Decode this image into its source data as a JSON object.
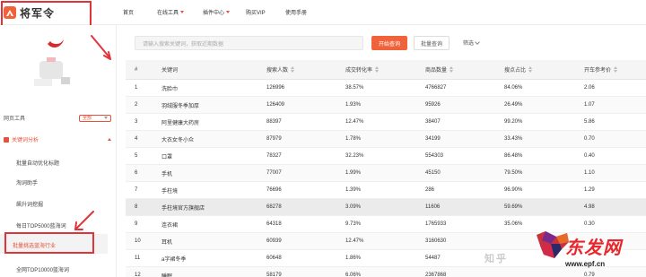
{
  "app": {
    "logo_text": "将军令"
  },
  "nav": [
    {
      "label": "首页",
      "has_caret": false
    },
    {
      "label": "在线工具",
      "has_caret": true
    },
    {
      "label": "插件中心",
      "has_caret": true
    },
    {
      "label": "购买VIP",
      "has_caret": false
    },
    {
      "label": "使用手册",
      "has_caret": false
    }
  ],
  "sidebar": {
    "tools_label": "网页工具",
    "tools_select": "全部",
    "category": "关键词分析",
    "items": [
      {
        "label": "批量自动优化标题",
        "active": false
      },
      {
        "label": "淘词助手",
        "active": false
      },
      {
        "label": "飙升词挖掘",
        "active": false
      },
      {
        "label": "每日TOP5000蓝海词",
        "active": false
      },
      {
        "label": "批量挑选蓝海行业",
        "active": true
      },
      {
        "label": "全网TOP10000蓝海词",
        "active": false
      }
    ]
  },
  "search": {
    "placeholder": "请输入搜索关键词，获取近期数据",
    "primary_button": "开始查询",
    "secondary_button": "批量查询",
    "filter_label": "筛选"
  },
  "table": {
    "columns": [
      "#",
      "关键词",
      "搜索人数",
      "成交转化率",
      "商品数量",
      "搜点占比",
      "开车参考价"
    ],
    "rows": [
      [
        "1",
        "洗脸巾",
        "126996",
        "38.57%",
        "4766827",
        "84.06%",
        "2.06"
      ],
      [
        "2",
        "羽绒服冬季加厚",
        "126409",
        "1.93%",
        "95926",
        "26.49%",
        "1.07"
      ],
      [
        "3",
        "阿里健康大药房",
        "88397",
        "12.47%",
        "38407",
        "99.20%",
        "5.86"
      ],
      [
        "4",
        "大衣女冬小众",
        "87979",
        "1.78%",
        "34199",
        "33.43%",
        "0.70"
      ],
      [
        "5",
        "口罩",
        "78327",
        "32.23%",
        "554303",
        "86.48%",
        "0.40"
      ],
      [
        "6",
        "手机",
        "77007",
        "1.99%",
        "45150",
        "79.50%",
        "1.10"
      ],
      [
        "7",
        "手柱境",
        "76696",
        "1.39%",
        "286",
        "96.90%",
        "1.29"
      ],
      [
        "8",
        "手柱境官方旗舰店",
        "68278",
        "3.09%",
        "11606",
        "59.69%",
        "4.98"
      ],
      [
        "9",
        "连衣裙",
        "64318",
        "9.73%",
        "1765933",
        "35.06%",
        "0.30"
      ],
      [
        "10",
        "耳机",
        "60939",
        "12.47%",
        "3160630",
        "",
        ""
      ],
      [
        "11",
        "a字裙冬季",
        "60648",
        "1.86%",
        "54487",
        "",
        ""
      ],
      [
        "12",
        "睡眠",
        "58179",
        "6.06%",
        "2367868",
        "",
        "0.79"
      ]
    ]
  },
  "watermark": {
    "grey_text": "知乎",
    "brand_text": "东发网",
    "url": "www.epf.cn"
  },
  "colors": {
    "accent": "#f0623a",
    "highlight_red": "#e0343a"
  }
}
